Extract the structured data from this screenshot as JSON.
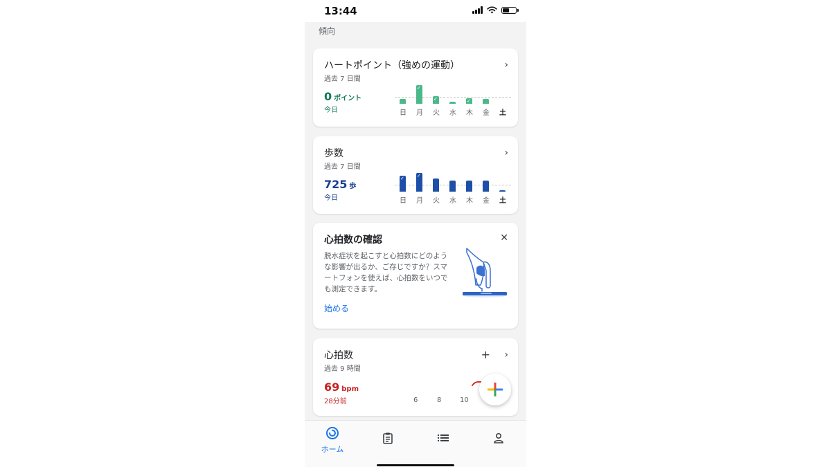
{
  "status": {
    "time": "13:44"
  },
  "section_title": "傾向",
  "heart_points": {
    "title": "ハートポイント（強めの運動）",
    "subtitle": "過去 7 日間",
    "value": "0",
    "unit": "ポイント",
    "today": "今日",
    "days": [
      "日",
      "月",
      "火",
      "水",
      "木",
      "金",
      "土"
    ],
    "values_relative": [
      0.25,
      1.0,
      0.4,
      0.1,
      0.3,
      0.25,
      0
    ],
    "goal_met": [
      false,
      true,
      true,
      false,
      true,
      false,
      false
    ],
    "color": "#4cb88a"
  },
  "steps": {
    "title": "歩数",
    "subtitle": "過去 7 日間",
    "value": "725",
    "unit": "歩",
    "today": "今日",
    "days": [
      "日",
      "月",
      "火",
      "水",
      "木",
      "金",
      "土"
    ],
    "values_relative": [
      0.85,
      1.0,
      0.7,
      0.6,
      0.6,
      0.6,
      0.08
    ],
    "goal_met": [
      true,
      true,
      false,
      false,
      false,
      false,
      false
    ],
    "color": "#1e4fa8"
  },
  "heart_rate_promo": {
    "title": "心拍数の確認",
    "body": "脱水症状を起こすと心拍数にどのような影響が出るか、ご存じですか？スマートフォンを使えば、心拍数をいつでも測定できます。",
    "link": "始める"
  },
  "heart_rate": {
    "title": "心拍数",
    "subtitle": "過去 9 時間",
    "value": "69",
    "unit": "bpm",
    "time_ago": "28分前",
    "x_ticks": [
      "6",
      "8",
      "10"
    ],
    "color": "#c5221f"
  },
  "nav": {
    "home_label": "ホーム",
    "accent": "#1a73e8"
  }
}
